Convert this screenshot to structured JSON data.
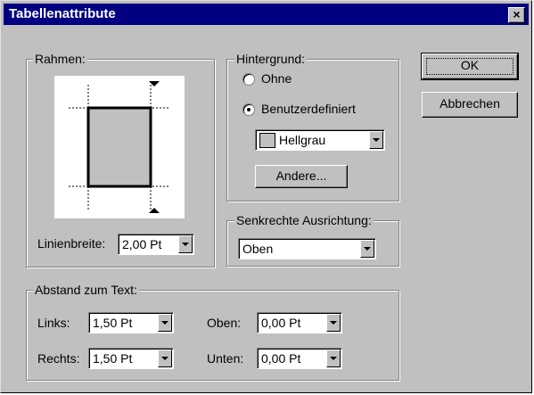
{
  "dialog": {
    "title": "Tabellenattribute",
    "close_glyph": "×"
  },
  "rahmen": {
    "legend": "Rahmen:",
    "linienbreite_label": "Linienbreite:",
    "linienbreite_value": "2,00 Pt"
  },
  "hintergrund": {
    "legend": "Hintergrund:",
    "options": [
      "Ohne",
      "Benutzerdefiniert"
    ],
    "selected": "Benutzerdefiniert",
    "color_value": "Hellgrau",
    "color_hex": "#c0c0c0",
    "andere_label": "Andere..."
  },
  "ausrichtung": {
    "legend": "Senkrechte Ausrichtung:",
    "value": "Oben"
  },
  "abstand": {
    "legend": "Abstand zum Text:",
    "links_label": "Links:",
    "links_value": "1,50 Pt",
    "rechts_label": "Rechts:",
    "rechts_value": "1,50 Pt",
    "oben_label": "Oben:",
    "oben_value": "0,00 Pt",
    "unten_label": "Unten:",
    "unten_value": "0,00 Pt"
  },
  "buttons": {
    "ok": "OK",
    "cancel": "Abbrechen"
  }
}
